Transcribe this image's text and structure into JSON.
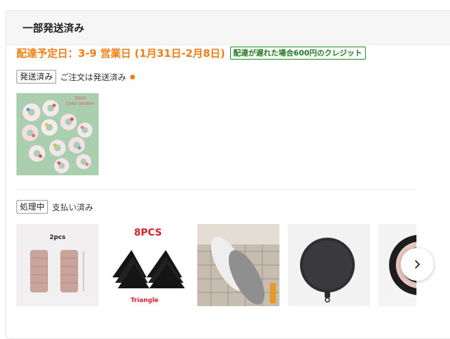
{
  "header": {
    "title": "一部発送済み"
  },
  "delivery": {
    "estimate": "配達予定日：3-9 営業日 (1月31日-2月8日)",
    "credit_badge": "配達が遅れた場合600円のクレジット",
    "color": "#f07d12"
  },
  "group1": {
    "tag": "発送済み",
    "status": "ご注文は発送済み",
    "items": [
      {
        "caption": "5pcs",
        "subcaption": "Color random"
      }
    ]
  },
  "group2": {
    "tag": "処理中",
    "status": "支払い済み",
    "items": [
      {
        "caption": "2pcs"
      },
      {
        "caption": "8PCS",
        "subcaption": "Triangle"
      },
      {
        "caption": ""
      },
      {
        "caption": ""
      },
      {
        "caption": ""
      }
    ]
  },
  "icons": {
    "next": "chevron-right-icon"
  }
}
